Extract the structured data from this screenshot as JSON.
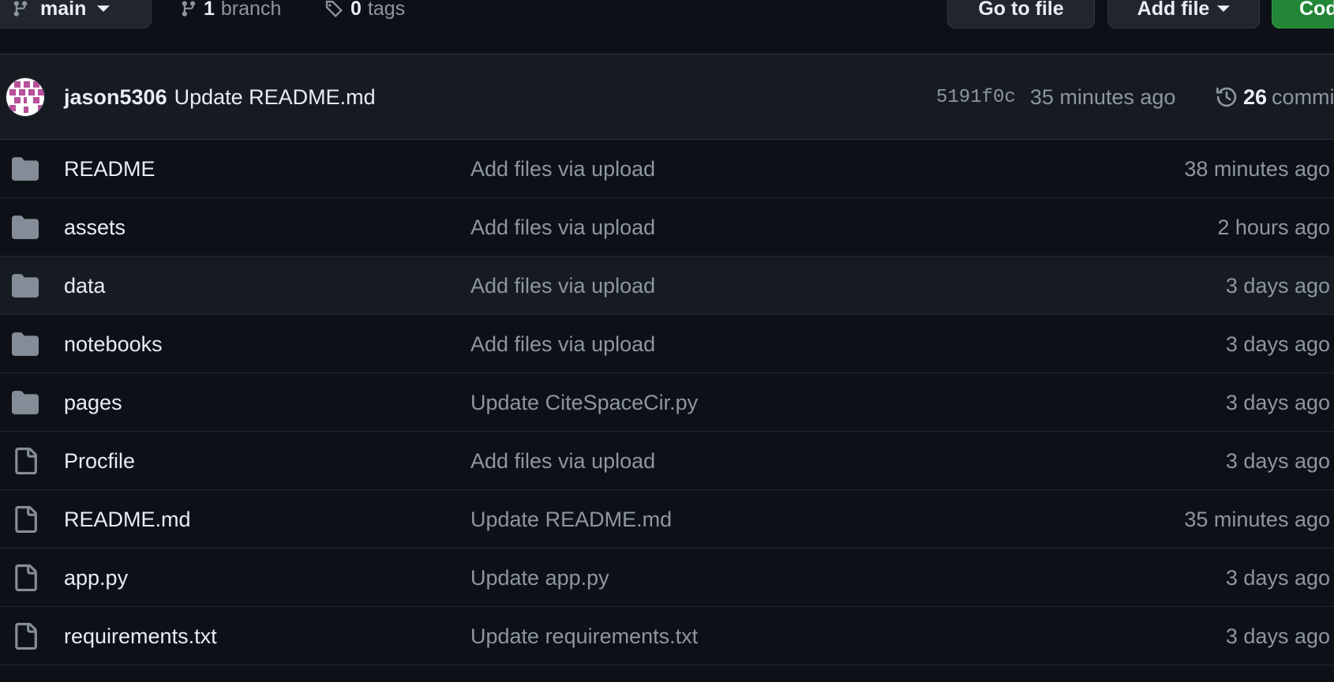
{
  "toolbar": {
    "branch_button": "main",
    "branch_count": "1",
    "branch_label": "branch",
    "tag_count": "0",
    "tag_label": "tags",
    "goto_file": "Go to file",
    "add_file": "Add file",
    "code_button": "Code"
  },
  "latest_commit": {
    "author": "jason5306",
    "message": "Update README.md",
    "sha": "5191f0c",
    "time": "35 minutes ago",
    "commit_count": "26",
    "commits_label": "commits"
  },
  "files": [
    {
      "type": "folder",
      "name": "README",
      "message": "Add files via upload",
      "age": "38 minutes ago"
    },
    {
      "type": "folder",
      "name": "assets",
      "message": "Add files via upload",
      "age": "2 hours ago"
    },
    {
      "type": "folder",
      "name": "data",
      "message": "Add files via upload",
      "age": "3 days ago"
    },
    {
      "type": "folder",
      "name": "notebooks",
      "message": "Add files via upload",
      "age": "3 days ago"
    },
    {
      "type": "folder",
      "name": "pages",
      "message": "Update CiteSpaceCir.py",
      "age": "3 days ago"
    },
    {
      "type": "file",
      "name": "Procfile",
      "message": "Add files via upload",
      "age": "3 days ago"
    },
    {
      "type": "file",
      "name": "README.md",
      "message": "Update README.md",
      "age": "35 minutes ago"
    },
    {
      "type": "file",
      "name": "app.py",
      "message": "Update app.py",
      "age": "3 days ago"
    },
    {
      "type": "file",
      "name": "requirements.txt",
      "message": "Update requirements.txt",
      "age": "3 days ago"
    }
  ],
  "icons": {
    "folder": "folder-icon",
    "file": "file-icon",
    "branch": "git-branch-icon",
    "tag": "tag-icon",
    "history": "history-icon"
  },
  "colors": {
    "background": "#0d1117",
    "header_row": "#161b22",
    "border": "#30363d",
    "text": "#e6edf3",
    "muted": "#8d96a0",
    "icon": "#848d97",
    "code_button": "#238636",
    "avatar": "#b8509a"
  }
}
